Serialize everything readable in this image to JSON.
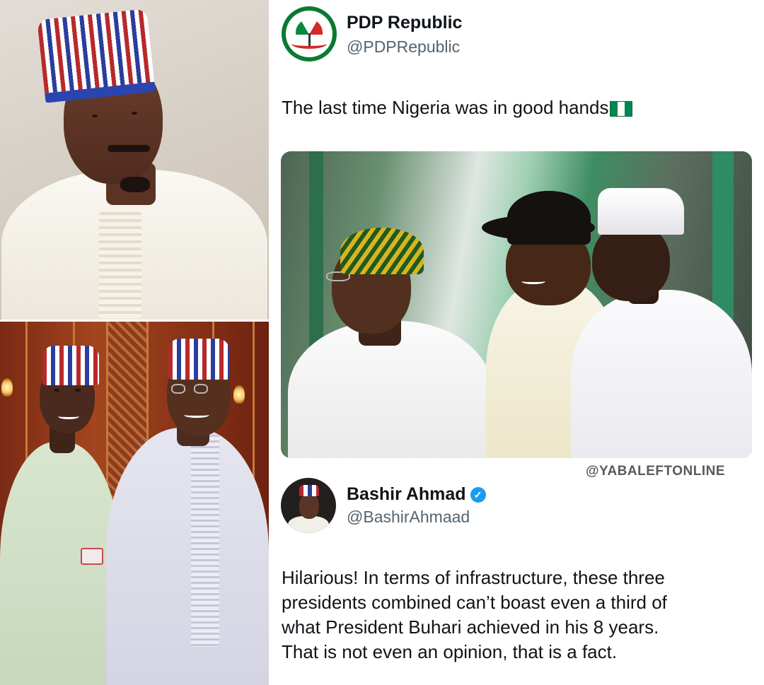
{
  "tweets": [
    {
      "name": "PDP Republic",
      "handle": "@PDPRepublic",
      "text": "The last time Nigeria was in good hands",
      "flag_icon": "nigeria-flag-icon"
    },
    {
      "name": "Bashir Ahmad",
      "handle": "@BashirAhmaad",
      "verified": true,
      "verified_icon": "verified-badge-icon",
      "text_lines": [
        "Hilarious! In terms of infrastructure, these three",
        "presidents combined can’t boast even a third of",
        "what President Buhari achieved in his 8 years.",
        "That is not even an opinion, that is a fact."
      ]
    }
  ],
  "watermark": "@YABALEFTONLINE",
  "colors": {
    "brand_green": "#0a7a32",
    "verified_blue": "#1d9bf0",
    "handle_gray": "#536471",
    "text_dark": "#0f1419"
  }
}
